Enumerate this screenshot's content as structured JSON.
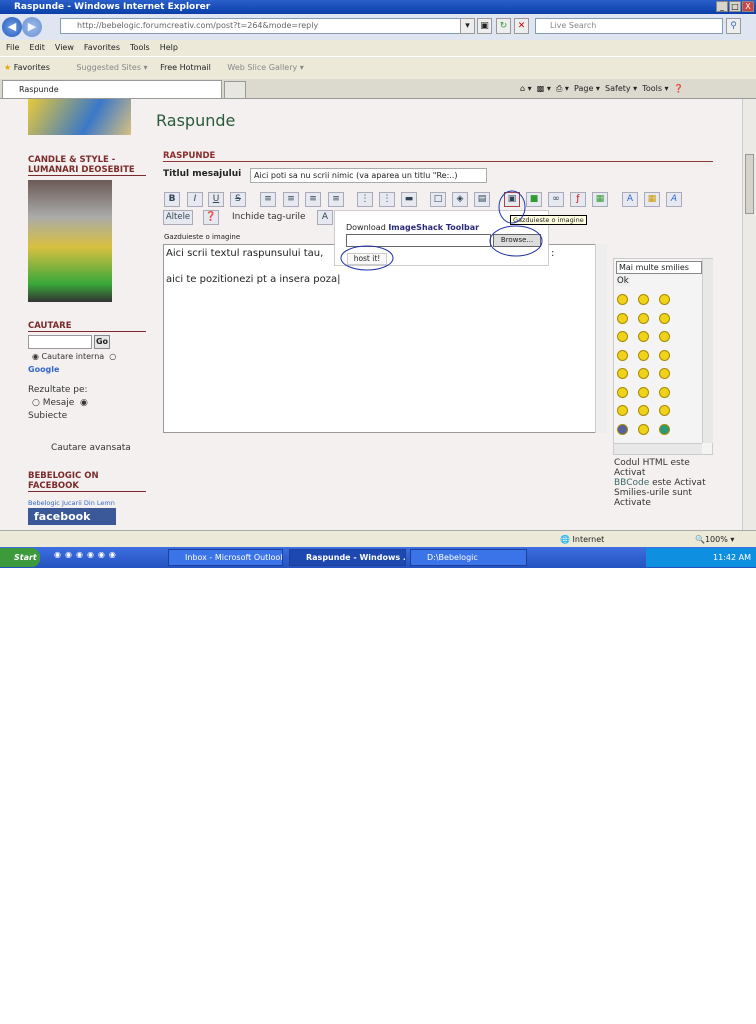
{
  "window": {
    "title": "Raspunde - Windows Internet Explorer",
    "min": "_",
    "max": "□",
    "close": "X"
  },
  "address": {
    "url": "http://bebelogic.forumcreativ.com/post?t=264&mode=reply",
    "search_placeholder": "Live Search"
  },
  "menu": [
    "File",
    "Edit",
    "View",
    "Favorites",
    "Tools",
    "Help"
  ],
  "favorites": {
    "label": "Favorites",
    "items": [
      "Suggested Sites ▾",
      "Free Hotmail",
      "Web Slice Gallery ▾"
    ]
  },
  "tab": {
    "label": "Raspunde"
  },
  "commandbar": [
    "Page ▾",
    "Safety ▾",
    "Tools ▾"
  ],
  "sidebar": {
    "candle_title": "CANDLE & STYLE - LUMANARI DEOSEBITE",
    "search_title": "CAUTARE",
    "go": "Go",
    "internal": "Cautare interna",
    "google": "Google",
    "results_on": "Rezultate pe:",
    "messages": "Mesaje",
    "subjects": "Subiecte",
    "advanced": "Cautare avansata",
    "fb_title": "BEBELOGIC ON FACEBOOK",
    "fb_link": "Bebelogic Jucarii Din Lemn",
    "fb_logo": "facebook"
  },
  "main": {
    "page_title": "Raspunde",
    "section": "RASPUNDE",
    "subject_label": "Titlul mesajului",
    "subject_value": "Aici poti sa nu scrii nimic (va aparea un titlu \"Re:..)",
    "toolbar": [
      "B",
      "I",
      "U",
      "S"
    ],
    "others": "Altele",
    "close_tags": "Inchide tag-urile",
    "host_label": "Gazduieste o imagine",
    "tooltip": "Gazduieste o imagine",
    "body_line1": "Aici scrii textul raspunsului tau,",
    "body_colon": ":",
    "body_line2": "aici te pozitionezi pt a insera poza",
    "popup": {
      "download": "Download ",
      "toolbar_link": "ImageShack Toolbar",
      "browse": "Browse...",
      "host": "host it!"
    },
    "smilies": {
      "select": "Mai multe smilies",
      "ok": "Ok"
    },
    "status": {
      "html": "Codul HTML este Activat",
      "bbcode": "BBCode",
      "bbcode_rest": " este Activat",
      "smilies": "Smilies-urile sunt Activate"
    }
  },
  "statusbar": {
    "zone": "Internet",
    "zoom": "100%"
  },
  "taskbar": {
    "start": "Start",
    "tasks": [
      "Inbox - Microsoft Outlook",
      "Raspunde - Windows ...",
      "D:\\Bebelogic"
    ],
    "clock": "11:42 AM"
  }
}
